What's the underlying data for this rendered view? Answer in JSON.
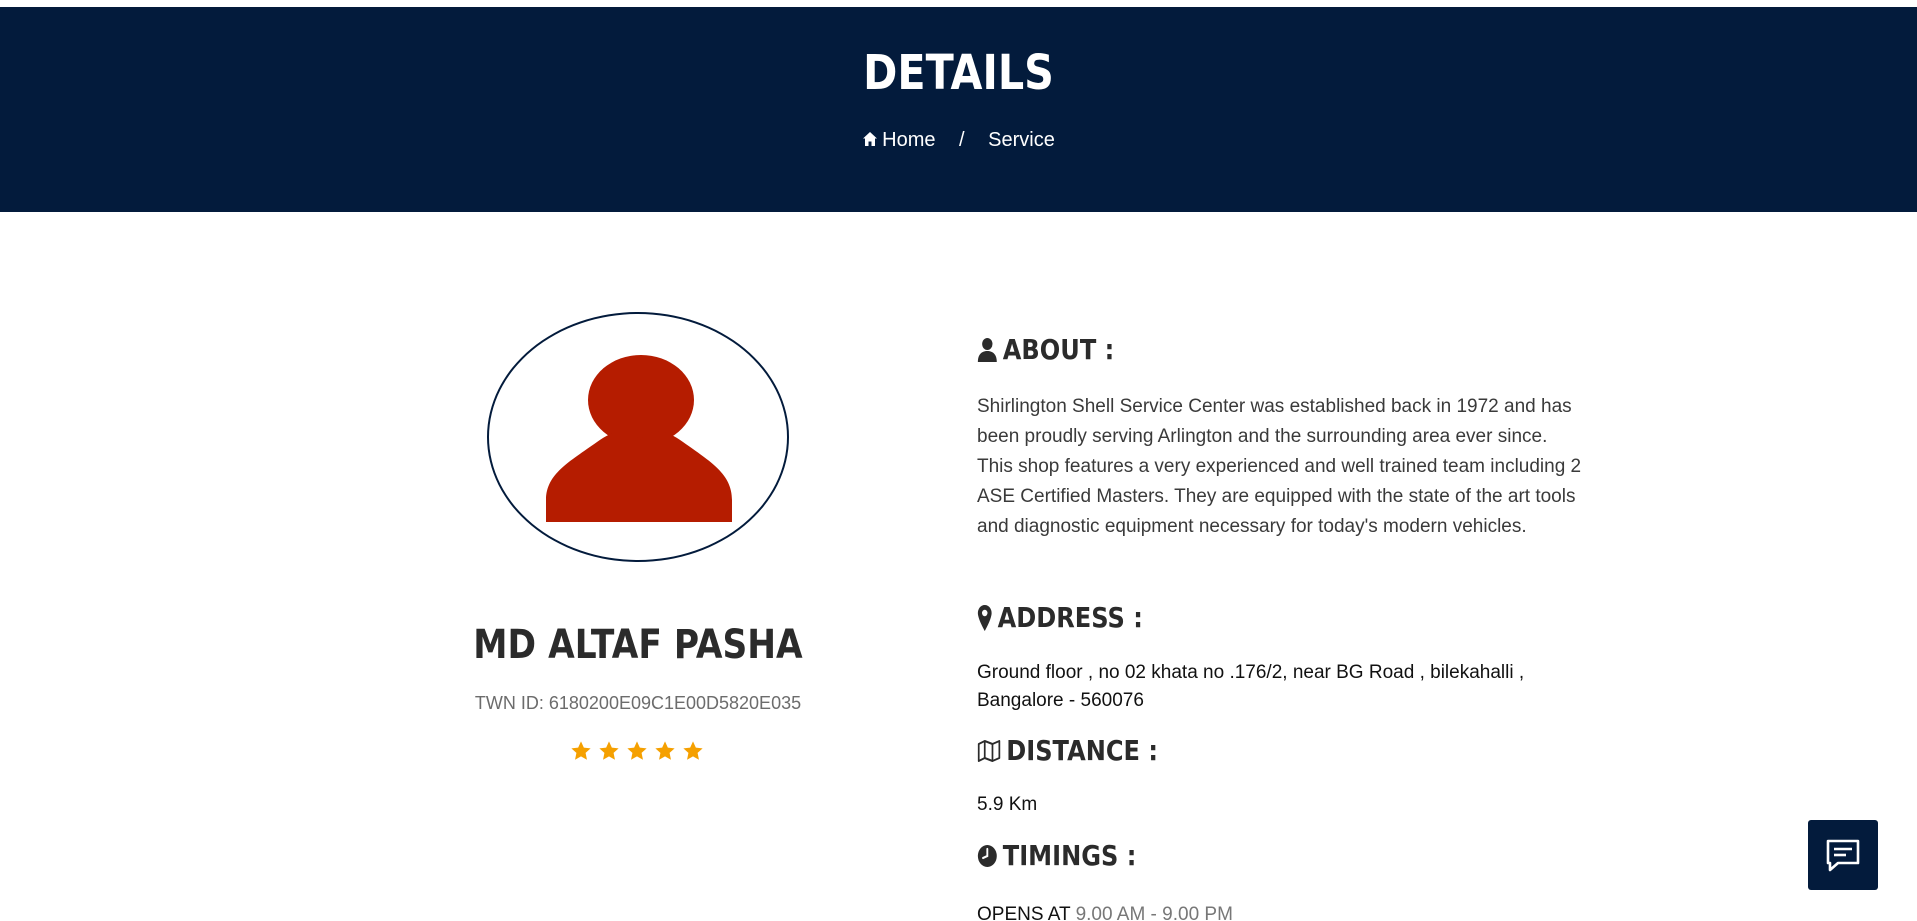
{
  "banner": {
    "title": "DETAILS",
    "breadcrumb": {
      "home": "Home",
      "separator": "/",
      "current": "Service"
    },
    "background": "#031b3c"
  },
  "profile": {
    "name": "MD ALTAF PASHA",
    "twn_id": "TWN ID: 6180200E09C1E00D5820E035",
    "rating": 5,
    "rating_max": 5,
    "avatar_color": "#b51c00",
    "star_color": "#f5a000"
  },
  "about": {
    "heading": "ABOUT :",
    "icon": "user-icon",
    "text": "Shirlington Shell Service Center was established back in 1972 and has been proudly serving Arlington and the surrounding area ever since. This shop features a very experienced and well trained team including 2 ASE Certified Masters. They are equipped with the state of the art tools and diagnostic equipment necessary for today's modern vehicles."
  },
  "address": {
    "heading": "ADDRESS :",
    "icon": "map-marker-icon",
    "text": "Ground floor , no 02 khata no .176/2, near BG Road , bilekahalli , Bangalore - 560076"
  },
  "distance": {
    "heading": "DISTANCE :",
    "icon": "map-icon",
    "text": "5.9 Km"
  },
  "timings": {
    "heading": "TIMINGS :",
    "icon": "clock-icon",
    "label": "OPENS AT",
    "hours": "9.00 AM - 9.00 PM"
  },
  "chat": {
    "icon": "chat-icon"
  }
}
